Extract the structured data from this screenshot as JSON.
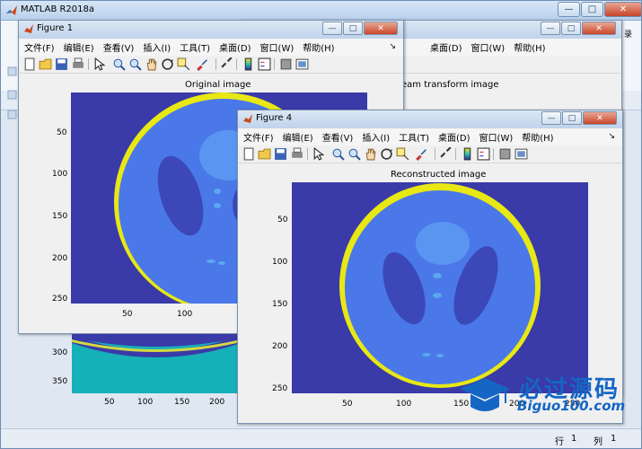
{
  "main_window": {
    "title": "MATLAB R2018a",
    "status_row_label": "行",
    "status_row_value": "1",
    "status_col_label": "列",
    "status_col_value": "1",
    "right_edge_text": "录",
    "colors": {
      "titlebar": "#c6daf1",
      "close": "#c6442a"
    }
  },
  "watermark": {
    "brand_text": "必过源码",
    "url_text": "Biguo100.com",
    "icon": "graduation-cap-icon",
    "color": "#1566c4"
  },
  "figure1": {
    "title": "Figure 1",
    "menus": [
      "文件(F)",
      "编辑(E)",
      "查看(V)",
      "插入(I)",
      "工具(T)",
      "桌面(D)",
      "窗口(W)",
      "帮助(H)"
    ],
    "plot_title": "Original image",
    "y_ticks": [
      "50",
      "100",
      "150",
      "200",
      "250"
    ],
    "x_ticks": [
      "50",
      "100"
    ]
  },
  "figure_behind": {
    "plot_title_fragment": "eam transform image",
    "menus_visible": [
      "桌面(D)",
      "窗口(W)",
      "帮助(H)"
    ],
    "y_ticks": [
      "300",
      "350"
    ],
    "x_ticks": [
      "50",
      "100",
      "150",
      "200"
    ]
  },
  "figure4": {
    "title": "Figure 4",
    "menus": [
      "文件(F)",
      "编辑(E)",
      "查看(V)",
      "插入(I)",
      "工具(T)",
      "桌面(D)",
      "窗口(W)",
      "帮助(H)"
    ],
    "plot_title": "Reconstructed image",
    "y_ticks": [
      "50",
      "100",
      "150",
      "200",
      "250"
    ],
    "x_ticks": [
      "50",
      "100",
      "150",
      "200",
      "250"
    ]
  },
  "image_colors": {
    "background": "#3a3aa8",
    "disk": "#4a78e8",
    "ring": "#e8e814",
    "inner_lobe": "#3c48b8",
    "sinogram_teal": "#16b0b8"
  },
  "toolbar_icons": [
    "new-file-icon",
    "open-folder-icon",
    "save-icon",
    "print-icon",
    "pointer-icon",
    "zoom-in-icon",
    "zoom-out-icon",
    "pan-hand-icon",
    "rotate-3d-icon",
    "data-cursor-icon",
    "brush-icon",
    "link-icon",
    "colorbar-icon",
    "legend-icon",
    "hide-plot-tools-icon",
    "show-plot-tools-icon"
  ],
  "window_controls": {
    "minimize": "—",
    "maximize": "□",
    "close": "✕"
  }
}
